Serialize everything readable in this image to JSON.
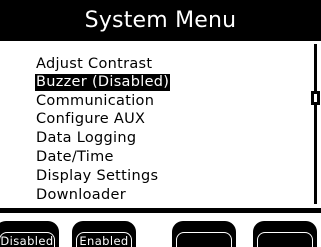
{
  "title": "System Menu",
  "menu": {
    "items": [
      {
        "label": "Adjust Contrast",
        "selected": false
      },
      {
        "label": "Buzzer (Disabled)",
        "selected": true
      },
      {
        "label": "Communication",
        "selected": false
      },
      {
        "label": "Configure AUX",
        "selected": false
      },
      {
        "label": "Data Logging",
        "selected": false
      },
      {
        "label": "Date/Time",
        "selected": false
      },
      {
        "label": "Display Settings",
        "selected": false
      },
      {
        "label": "Downloader",
        "selected": false
      }
    ]
  },
  "softkeys": [
    {
      "label": "Disabled"
    },
    {
      "label": "Enabled"
    },
    {
      "label": ""
    },
    {
      "label": ""
    }
  ],
  "colors": {
    "foreground": "#000000",
    "background": "#ffffff"
  }
}
